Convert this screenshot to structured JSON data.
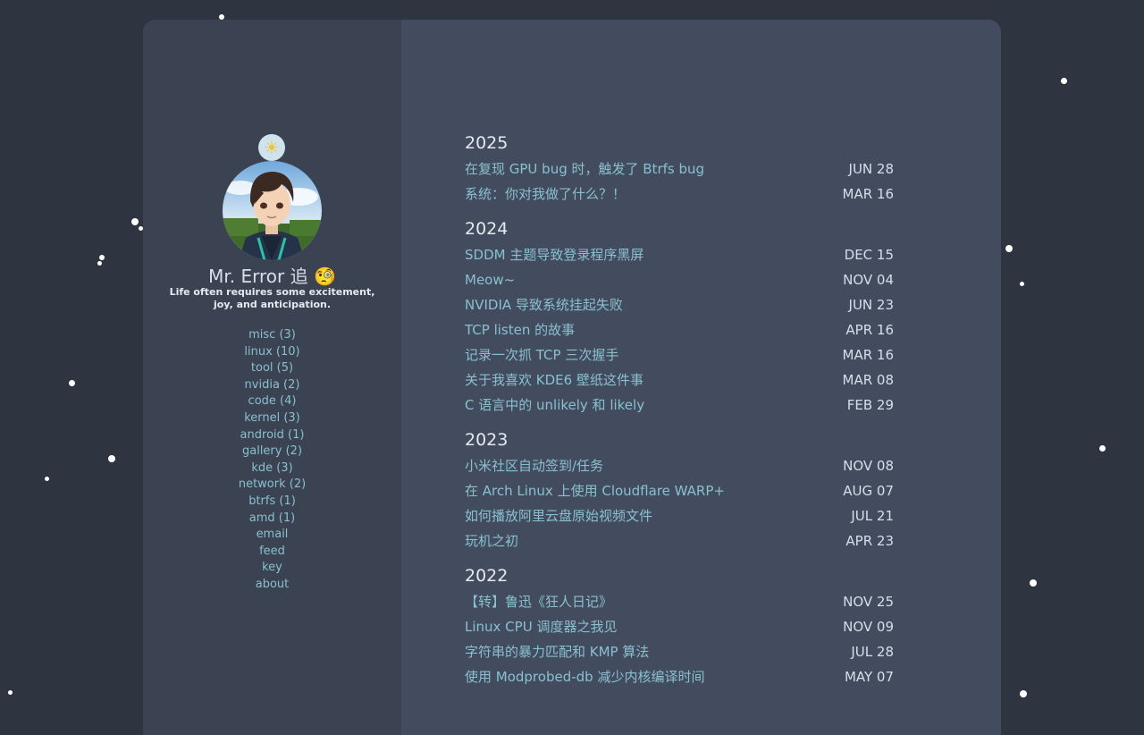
{
  "profile": {
    "weather_icon": "sun-behind-cloud-icon",
    "avatar_icon": "anime-character-avatar",
    "name": "Mr. Error 追 🧐",
    "tagline": "Life often requires some excitement, joy, and anticipation."
  },
  "nav": {
    "items": [
      "misc (3)",
      "linux (10)",
      "tool (5)",
      "nvidia (2)",
      "code (4)",
      "kernel (3)",
      "android (1)",
      "gallery (2)",
      "kde (3)",
      "network (2)",
      "btrfs (1)",
      "amd (1)",
      "email",
      "feed",
      "key",
      "about"
    ]
  },
  "archive": [
    {
      "year": "2025",
      "posts": [
        {
          "title": "在复现 GPU bug 时，触发了 Btrfs bug",
          "date": "JUN 28"
        },
        {
          "title": "系统：你对我做了什么？！",
          "date": "MAR 16"
        }
      ]
    },
    {
      "year": "2024",
      "posts": [
        {
          "title": "SDDM 主题导致登录程序黑屏",
          "date": "DEC 15"
        },
        {
          "title": "Meow~",
          "date": "NOV 04"
        },
        {
          "title": "NVIDIA 导致系统挂起失败",
          "date": "JUN 23"
        },
        {
          "title": "TCP listen 的故事",
          "date": "APR 16"
        },
        {
          "title": "记录一次抓 TCP 三次握手",
          "date": "MAR 16"
        },
        {
          "title": "关于我喜欢 KDE6 壁纸这件事",
          "date": "MAR 08"
        },
        {
          "title": "C 语言中的 unlikely 和 likely",
          "date": "FEB 29"
        }
      ]
    },
    {
      "year": "2023",
      "posts": [
        {
          "title": "小米社区自动签到/任务",
          "date": "NOV 08"
        },
        {
          "title": "在 Arch Linux 上使用 Cloudflare WARP+",
          "date": "AUG 07"
        },
        {
          "title": "如何播放阿里云盘原始视频文件",
          "date": "JUL 21"
        },
        {
          "title": "玩机之初",
          "date": "APR 23"
        }
      ]
    },
    {
      "year": "2022",
      "posts": [
        {
          "title": "【转】鲁迅《狂人日记》",
          "date": "NOV 25"
        },
        {
          "title": "Linux CPU 调度器之我见",
          "date": "NOV 09"
        },
        {
          "title": "字符串的暴力匹配和 KMP 算法",
          "date": "JUL 28"
        },
        {
          "title": "使用 Modprobed-db 减少内核编译时间",
          "date": "MAY 07"
        }
      ]
    }
  ],
  "colors": {
    "background": "#2e3440",
    "sidebar": "#3b4252",
    "content": "#434c5e",
    "link": "#88c0d0",
    "text": "#d8dee9"
  }
}
